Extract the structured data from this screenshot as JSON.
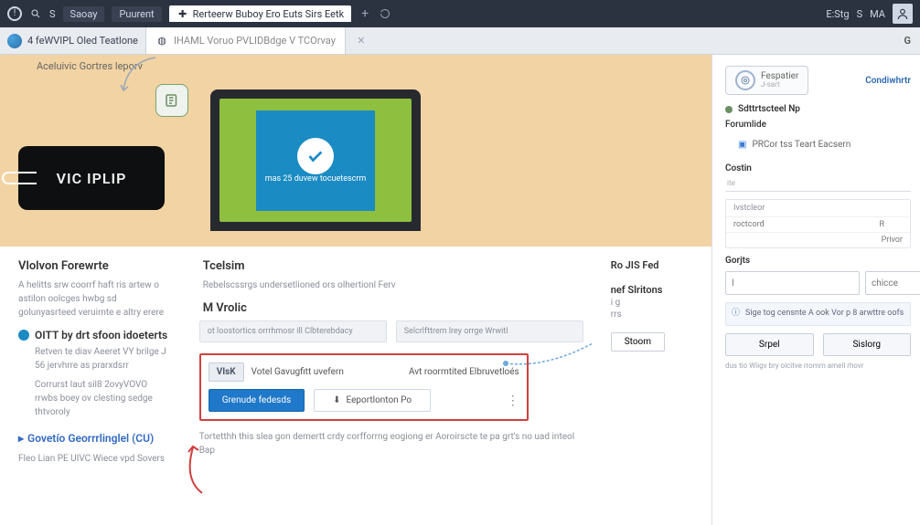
{
  "topbar": {
    "brand": "S",
    "chip1": "Saoay",
    "chip2": "Puurent",
    "tab_title": "Rerteerw Buboy Ero Euts Sirs Eetk",
    "right1": "E:Stg",
    "right2": "S",
    "right3": "MA"
  },
  "tabs": {
    "a": "4 feWVIPL Oled Teatlone",
    "b": "IHAML Voruo PVLIDBdge V TCOrvay",
    "right": "G"
  },
  "banner": {
    "crumb": "Aceluivic Gortres leporv",
    "badge": "VIC IPLIP",
    "blue_caption": "mas 25 duvew tocuetescrm"
  },
  "left": {
    "h1": "Vlolvon Forewrte",
    "p1": "A helitts srw coorrf haft ris artew o astilon oolcges hwbg sd golunyasrteed veruimte e altry erere",
    "h2": "OITT by drt sfoon idoeterts",
    "p2a": "Retven te diav Aeeret VY brilge J 56 jervhrre as prarxdsrr",
    "p2b": "Corrurst laut sil8 2ovyVOVO rrwbs boey ov clesting sedge thtvoroly",
    "h3": "Govetío Georrrlinglel (CU)",
    "foot": "Fleo Lian PE UIVC Wiece vpd Sovers"
  },
  "mid": {
    "h1": "Tcelsim",
    "p1": "Rebelscssrgs undersetlioned ors olhertionl Ferv",
    "h2": "M Vrolic",
    "card1": "ot loostortics orrrhmosr ill Clbterebdacy",
    "card2": "Selcrlfttrem lrey orrge Wrwitl",
    "vik": "VIsK",
    "vik_a": "Votel Gavugfitt uvefern",
    "vik_b": "Avt roormtited Elbruvetloés",
    "primary": "Grenude fedesds",
    "secondary": "Eeportlonton Po",
    "footnote": "Tortetthh this slea gon demertt crdy corfforrng eogiong er Aoroirscte te pa grt's no uad inteol Bap"
  },
  "right": {
    "k1": "Ro JIS Fed",
    "k2": "nef Slritons",
    "v1": "i g",
    "v2": "rrs",
    "btn": "Stoom"
  },
  "sidebar": {
    "pill": "Fespatier",
    "pill_sub": "J-sart",
    "link": "Condiwhrtr",
    "sec1": "Sdttrtscteel Np",
    "sec2": "Forumlide",
    "row1": "PRCor tss Teart Eacsern",
    "sec3": "Costin",
    "small_lbl": "ite",
    "hd": "Ivstcleor",
    "rw1a": "roctcord",
    "rw1b": "R",
    "rw2": "Privor",
    "sec4": "Gorjts",
    "ph1": "I",
    "ph2": "chicce",
    "info": "Sige tog censnte A ook Vor p 8 arwttre oofs",
    "btn1": "Srpel",
    "btn2": "Sislorg",
    "tiny": "dus tio Wiigv bry olcitve rromm amell rhovr"
  }
}
